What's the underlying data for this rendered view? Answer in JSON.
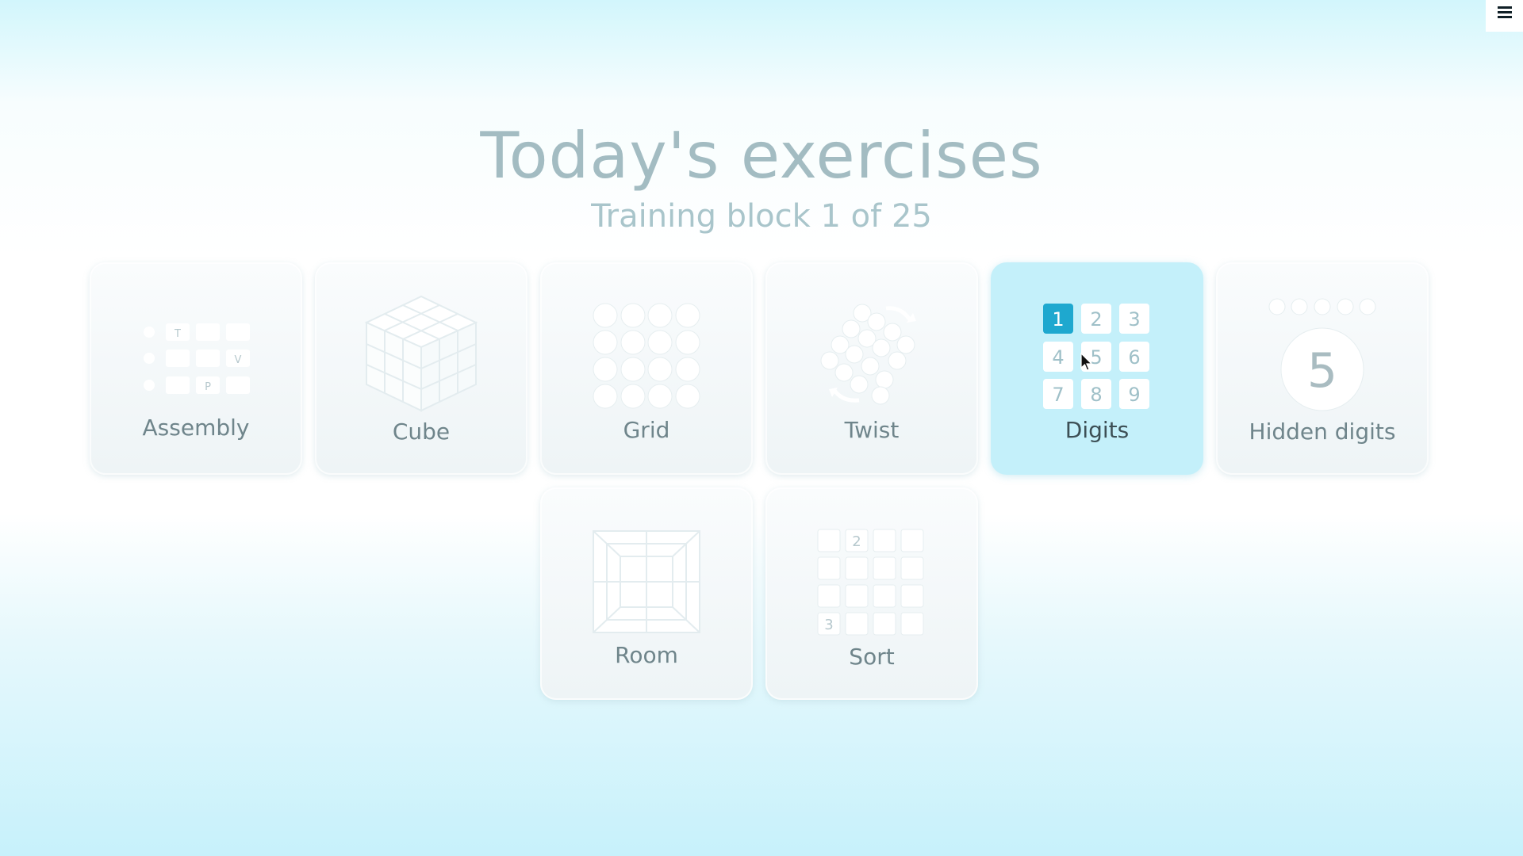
{
  "header": {
    "title": "Today's exercises",
    "subtitle": "Training block 1 of 25"
  },
  "menu": {
    "icon": "hamburger-menu-icon"
  },
  "exercises": [
    {
      "label": "Assembly",
      "icon": "assembly-icon",
      "glyphs": [
        "T",
        "V",
        "P"
      ]
    },
    {
      "label": "Cube",
      "icon": "cube-icon"
    },
    {
      "label": "Grid",
      "icon": "grid-icon"
    },
    {
      "label": "Twist",
      "icon": "twist-icon"
    },
    {
      "label": "Digits",
      "icon": "digits-icon",
      "selected": true,
      "digits": [
        "1",
        "2",
        "3",
        "4",
        "5",
        "6",
        "7",
        "8",
        "9"
      ]
    },
    {
      "label": "Hidden digits",
      "icon": "hidden-digits-icon",
      "digit": "5"
    },
    {
      "label": "Room",
      "icon": "room-icon"
    },
    {
      "label": "Sort",
      "icon": "sort-icon",
      "digits": [
        "2",
        "3"
      ]
    }
  ],
  "colors": {
    "accent": "#1ea8cf",
    "selected_tile": "#c4f0fa",
    "title": "#a3bcc2"
  }
}
